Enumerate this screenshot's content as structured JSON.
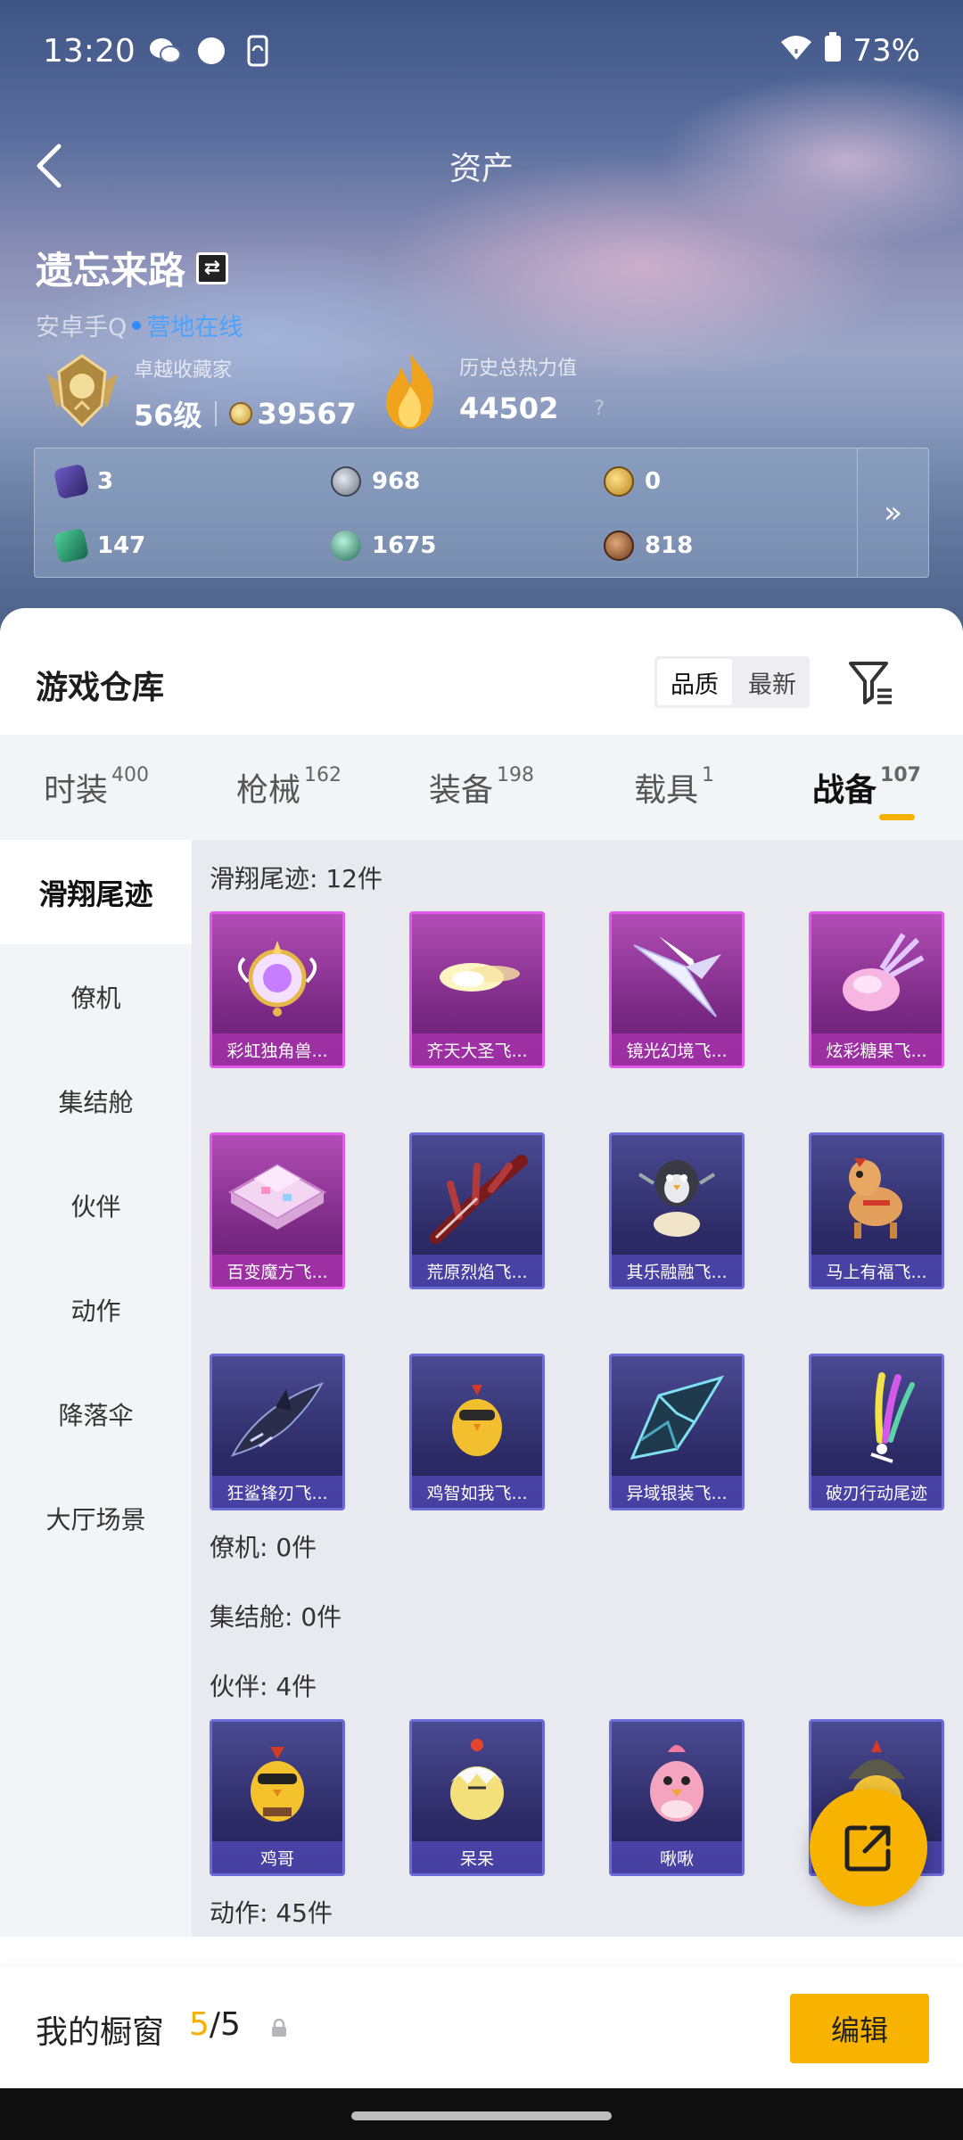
{
  "status_bar": {
    "time": "13:20",
    "battery": "73%"
  },
  "nav": {
    "title": "资产"
  },
  "profile": {
    "name": "遗忘来路",
    "platform": "安卓手Q",
    "online_status": "营地在线",
    "rank_title": "卓越收藏家",
    "level": "56级",
    "collection_points": "39567",
    "heat_label": "历史总热力值",
    "heat_value": "44502",
    "heat_help": "?"
  },
  "currency": [
    {
      "icon": "purple-card-icon",
      "value": "3"
    },
    {
      "icon": "silver-coin-icon",
      "value": "968"
    },
    {
      "icon": "gold-coin-icon",
      "value": "0"
    },
    {
      "icon": "green-card-icon",
      "value": "147"
    },
    {
      "icon": "green-orb-icon",
      "value": "1675"
    },
    {
      "icon": "bronze-coin-icon",
      "value": "818"
    }
  ],
  "warehouse": {
    "title": "游戏仓库",
    "sort_options": [
      "品质",
      "最新"
    ],
    "sort_selected": "品质",
    "categories": [
      {
        "label": "时装",
        "count": "400"
      },
      {
        "label": "枪械",
        "count": "162"
      },
      {
        "label": "装备",
        "count": "198"
      },
      {
        "label": "载具",
        "count": "1"
      },
      {
        "label": "战备",
        "count": "107"
      }
    ],
    "active_category": "战备",
    "sidebar": [
      "滑翔尾迹",
      "僚机",
      "集结舱",
      "伙伴",
      "动作",
      "降落伞",
      "大厅场景"
    ],
    "sidebar_active": "滑翔尾迹",
    "sections": {
      "glide": {
        "title": "滑翔尾迹: 12件",
        "items": [
          {
            "label": "彩虹独角兽...",
            "rarity": "pink"
          },
          {
            "label": "齐天大圣飞...",
            "rarity": "pink"
          },
          {
            "label": "镜光幻境飞...",
            "rarity": "pink"
          },
          {
            "label": "炫彩糖果飞...",
            "rarity": "pink"
          },
          {
            "label": "百变魔方飞...",
            "rarity": "pink"
          },
          {
            "label": "荒原烈焰飞...",
            "rarity": "blue"
          },
          {
            "label": "其乐融融飞...",
            "rarity": "blue"
          },
          {
            "label": "马上有福飞...",
            "rarity": "blue"
          },
          {
            "label": "狂鲨锋刃飞...",
            "rarity": "blue"
          },
          {
            "label": "鸡智如我飞...",
            "rarity": "blue"
          },
          {
            "label": "异域银装飞...",
            "rarity": "blue"
          },
          {
            "label": "破刃行动尾迹",
            "rarity": "blue"
          }
        ]
      },
      "wingman": {
        "title": "僚机: 0件"
      },
      "pod": {
        "title": "集结舱: 0件"
      },
      "companion": {
        "title": "伙伴: 4件",
        "items": [
          {
            "label": "鸡哥",
            "rarity": "blue"
          },
          {
            "label": "呆呆",
            "rarity": "blue"
          },
          {
            "label": "啾啾",
            "rarity": "blue"
          },
          {
            "label": "",
            "rarity": "blue"
          }
        ]
      },
      "emote": {
        "title": "动作: 45件"
      }
    }
  },
  "showcase": {
    "label": "我的橱窗",
    "current": "5",
    "total": "/5",
    "edit_label": "编辑"
  },
  "colors": {
    "accent": "#f7b300",
    "link": "#4aa3ff",
    "pink_rarity": "#e25ae8",
    "blue_rarity": "#6d6bd8"
  }
}
